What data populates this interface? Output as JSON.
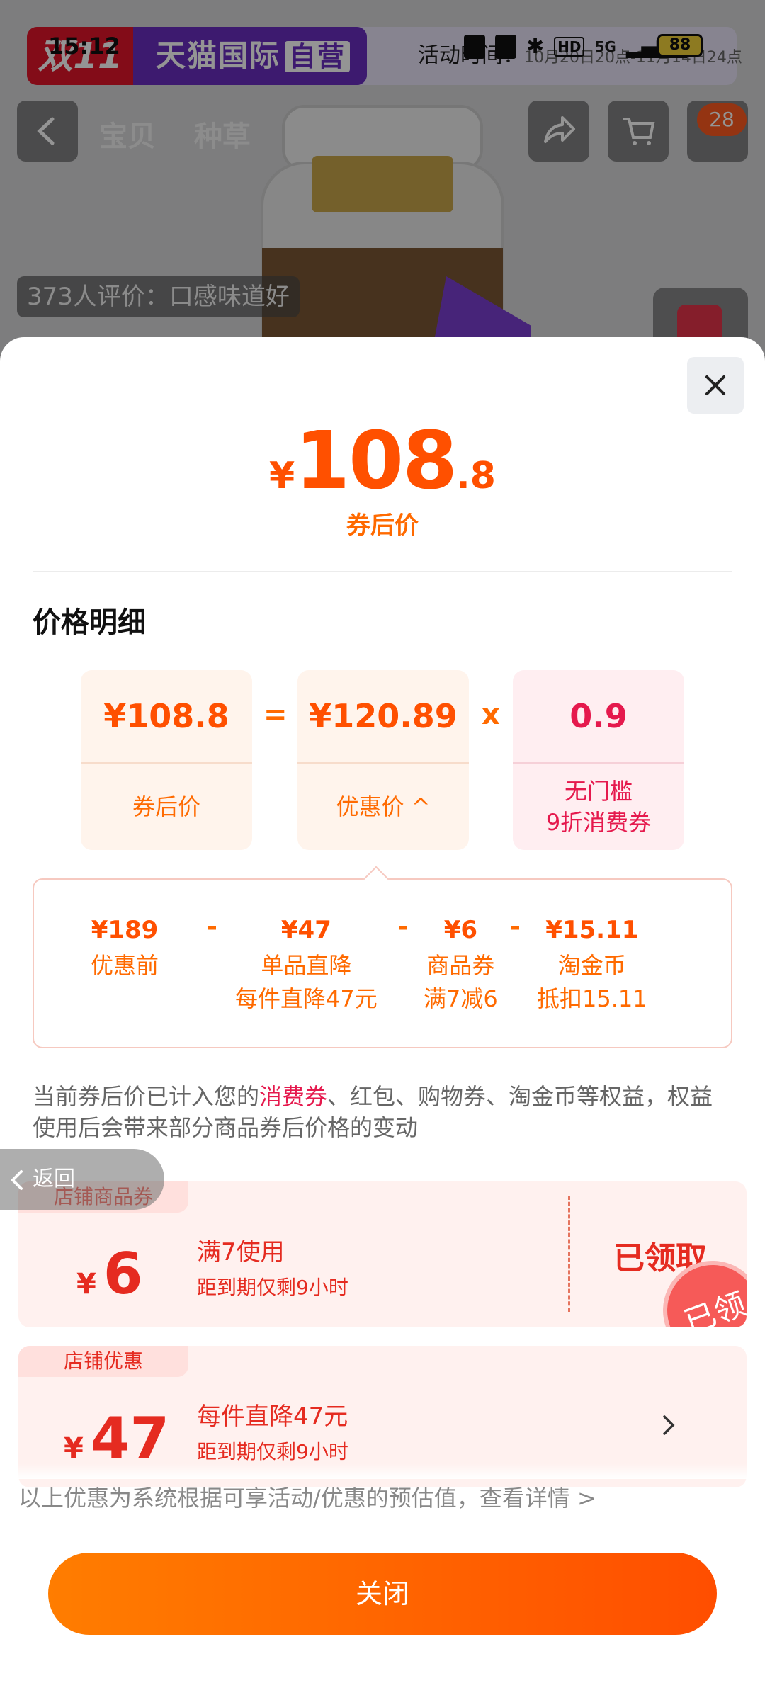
{
  "status_bar": {
    "time": "15:12",
    "net": "5G",
    "battery": "88",
    "hd": "HD"
  },
  "banner": {
    "badge": "双11",
    "store": "天猫国际",
    "store_tag": "自营",
    "activity": "活动时间：",
    "activity_dates": "10月20日20点-11月14日24点"
  },
  "product_nav": {
    "tabs": [
      "宝贝",
      "种草"
    ],
    "cart_count": "28",
    "review_tag": "373人评价：口感味道好"
  },
  "sheet": {
    "price": {
      "currency": "¥",
      "integer": "108",
      "decimal": ".8",
      "label": "券后价"
    },
    "section_title": "价格明细",
    "calc": {
      "cards": [
        {
          "value": "¥108.8",
          "label": "券后价"
        },
        {
          "value": "¥120.89",
          "label": "优惠价 ^"
        },
        {
          "value": "0.9",
          "label": "无门槛\n9折消费券"
        }
      ],
      "ops": [
        "=",
        "x"
      ]
    },
    "breakdown": [
      {
        "amount": "¥189",
        "title": "优惠前",
        "sub": ""
      },
      {
        "amount": "¥47",
        "title": "单品直降",
        "sub": "每件直降47元"
      },
      {
        "amount": "¥6",
        "title": "商品券",
        "sub": "满7减6"
      },
      {
        "amount": "¥15.11",
        "title": "淘金币",
        "sub": "抵扣15.11"
      }
    ],
    "notice": {
      "before": "当前券后价已计入您的",
      "highlight": "消费券",
      "after": "、红包、购物券、淘金币等权益，权益使用后会带来部分商品券后价格的变动"
    },
    "coupons": [
      {
        "tag": "店铺商品券",
        "currency": "¥",
        "amount": "6",
        "title": "满7使用",
        "sub": "距到期仅剩9小时",
        "action": "已领取",
        "stamp": "已领"
      },
      {
        "tag": "店铺优惠",
        "currency": "¥",
        "amount": "47",
        "title": "每件直降47元",
        "sub": "距到期仅剩9小时"
      }
    ],
    "footnote": "以上优惠为系统根据可享活动/优惠的预估值，查看详情 >",
    "close_label": "关闭"
  },
  "back_float": "返回",
  "colors": {
    "accent": "#ff5000",
    "pink": "#e5194d",
    "coupon_red": "#e52b20"
  }
}
